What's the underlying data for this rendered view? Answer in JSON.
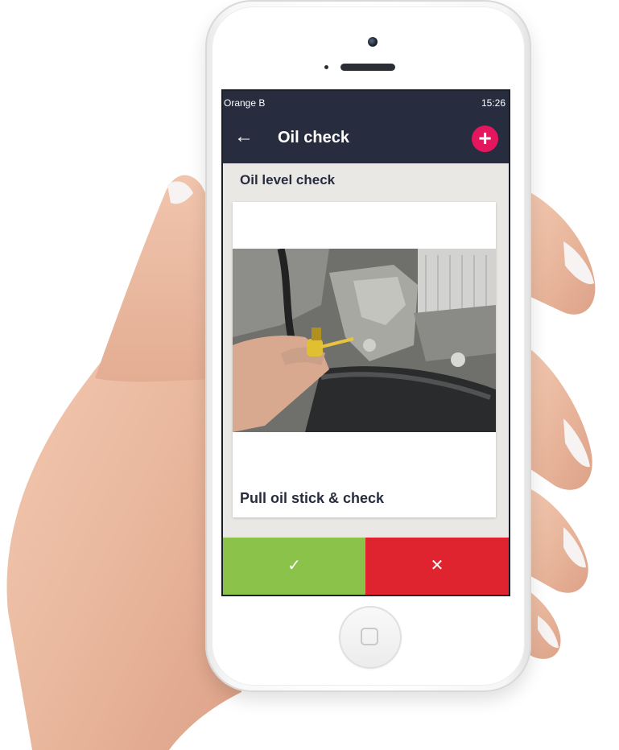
{
  "status_bar": {
    "carrier": "Orange B",
    "time": "15:26"
  },
  "app_bar": {
    "title": "Oil check",
    "back_icon": "arrow-left-icon",
    "add_icon": "plus-icon",
    "accent_color": "#e4175e"
  },
  "section": {
    "title": "Oil level check"
  },
  "card": {
    "caption": "Pull oil stick & check",
    "image": "engine-oil-dipstick-photo"
  },
  "actions": {
    "confirm": {
      "icon": "checkmark-icon",
      "glyph": "✓",
      "color": "#8bc24a"
    },
    "reject": {
      "icon": "cross-icon",
      "glyph": "✕",
      "color": "#e0242f"
    }
  },
  "theme": {
    "header_color": "#272d3f",
    "background": "#e9e8e4"
  }
}
